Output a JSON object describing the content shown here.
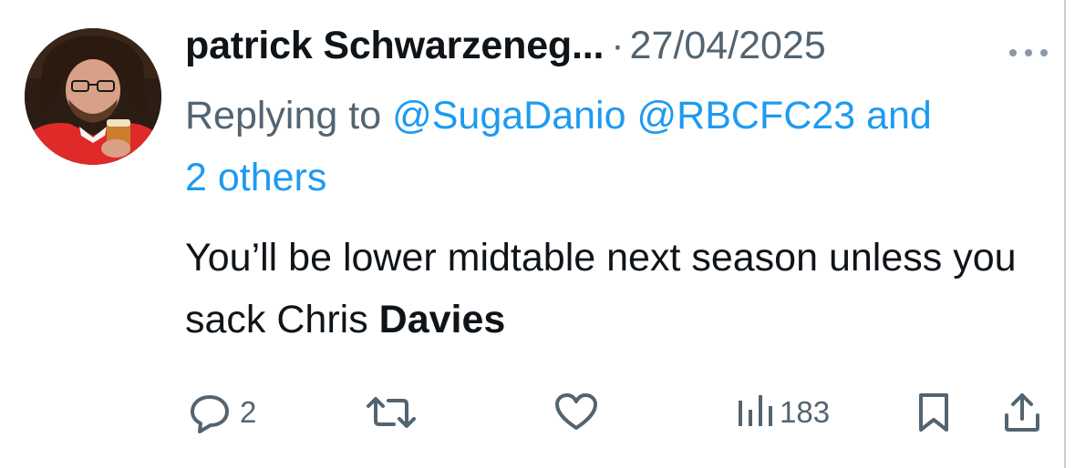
{
  "tweet": {
    "author_name": "patrick Schwarzeneg...",
    "separator": "·",
    "date": "27/04/2025",
    "reply_prefix": "Replying to",
    "mention_1": "@SugaDanio",
    "mention_2": "@RBCFC23",
    "reply_and": "and",
    "reply_others": "2 others",
    "text_main": "You’ll be lower midtable next season unless you sack Chris",
    "text_bold": "Davies",
    "replies_count": "2",
    "views_count": "183"
  },
  "icons": {
    "more": "more-horizontal-icon",
    "reply": "comment-bubble-icon",
    "retweet": "retweet-icon",
    "like": "heart-icon",
    "views": "bar-chart-icon",
    "bookmark": "bookmark-icon",
    "share": "share-icon"
  },
  "colors": {
    "mention": "#1d9bf0",
    "secondary_text": "#536471",
    "primary_text": "#0f1419"
  }
}
